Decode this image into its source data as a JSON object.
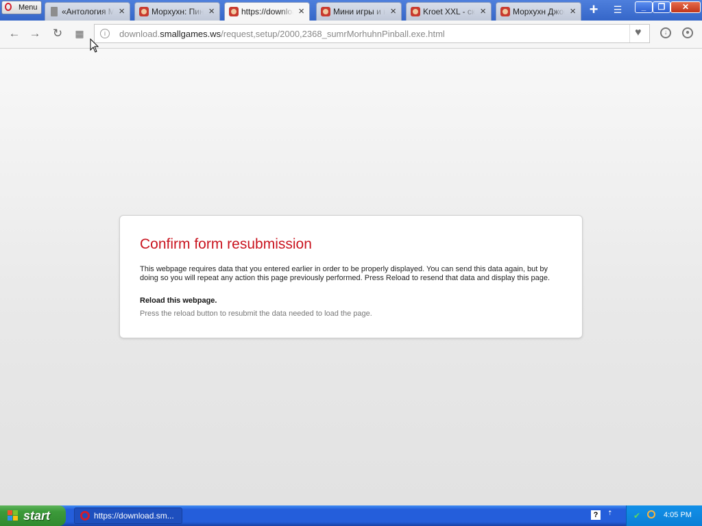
{
  "browser": {
    "menu_label": "Menu",
    "tabs": [
      {
        "title": "«Антология Мор",
        "favicon": "doc-icon",
        "active": false
      },
      {
        "title": "Морхухн: ПинБол",
        "favicon": "game-icon",
        "active": false
      },
      {
        "title": "https://download.smallgames.ws",
        "favicon": "game-icon",
        "active": true
      },
      {
        "title": "Мини игры и кар",
        "favicon": "game-icon",
        "active": false
      },
      {
        "title": "Kroet XXL - скач",
        "favicon": "game-icon",
        "active": false
      },
      {
        "title": "Морхухн Джонс",
        "favicon": "game-icon",
        "active": false
      }
    ],
    "url": {
      "prefix": "download.",
      "host": "smallgames.ws",
      "path": "/request,setup/2000,2368_sumrMorhuhnPinball.exe.html"
    }
  },
  "page": {
    "title": "Confirm form resubmission",
    "body": "This webpage requires data that you entered earlier in order to be properly displayed. You can send this data again, but by doing so you will repeat any action this page previously performed. Press Reload to resend that data and display this page.",
    "subheading": "Reload this webpage.",
    "hint": "Press the reload button to resubmit the data needed to load the page."
  },
  "taskbar": {
    "start_label": "start",
    "task_label": "https://download.sm...",
    "clock": "4:05 PM"
  },
  "colors": {
    "error_title": "#c9141f",
    "opera_red": "#d21d2c",
    "xp_blue": "#245edb",
    "xp_green": "#3c9a3a"
  }
}
